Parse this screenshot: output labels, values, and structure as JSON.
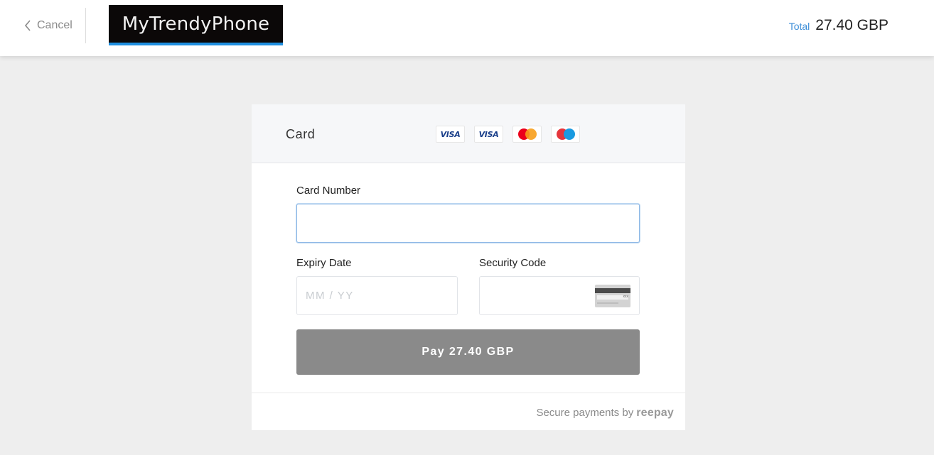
{
  "header": {
    "cancel_label": "Cancel",
    "logo_text": "MyTrendyPhone",
    "total_label": "Total",
    "total_amount": "27.40 GBP"
  },
  "card_panel": {
    "title": "Card",
    "brand_icons": [
      "visa-icon",
      "visa-electron-icon",
      "mastercard-icon",
      "maestro-icon"
    ],
    "visa_text": "VISA",
    "visa_electron_text": "VISA",
    "card_number": {
      "label": "Card Number",
      "value": ""
    },
    "expiry": {
      "label": "Expiry Date",
      "placeholder": "MM / YY",
      "value": ""
    },
    "security_code": {
      "label": "Security Code",
      "value": ""
    },
    "pay_button_label": "Pay 27.40 GBP",
    "footer_text": "Secure payments by",
    "footer_brand": "reepay"
  },
  "colors": {
    "accent": "#1f8fe0",
    "total_label": "#3d8ed8",
    "pay_button": "#8a8a8a",
    "background": "#eeeeee"
  }
}
